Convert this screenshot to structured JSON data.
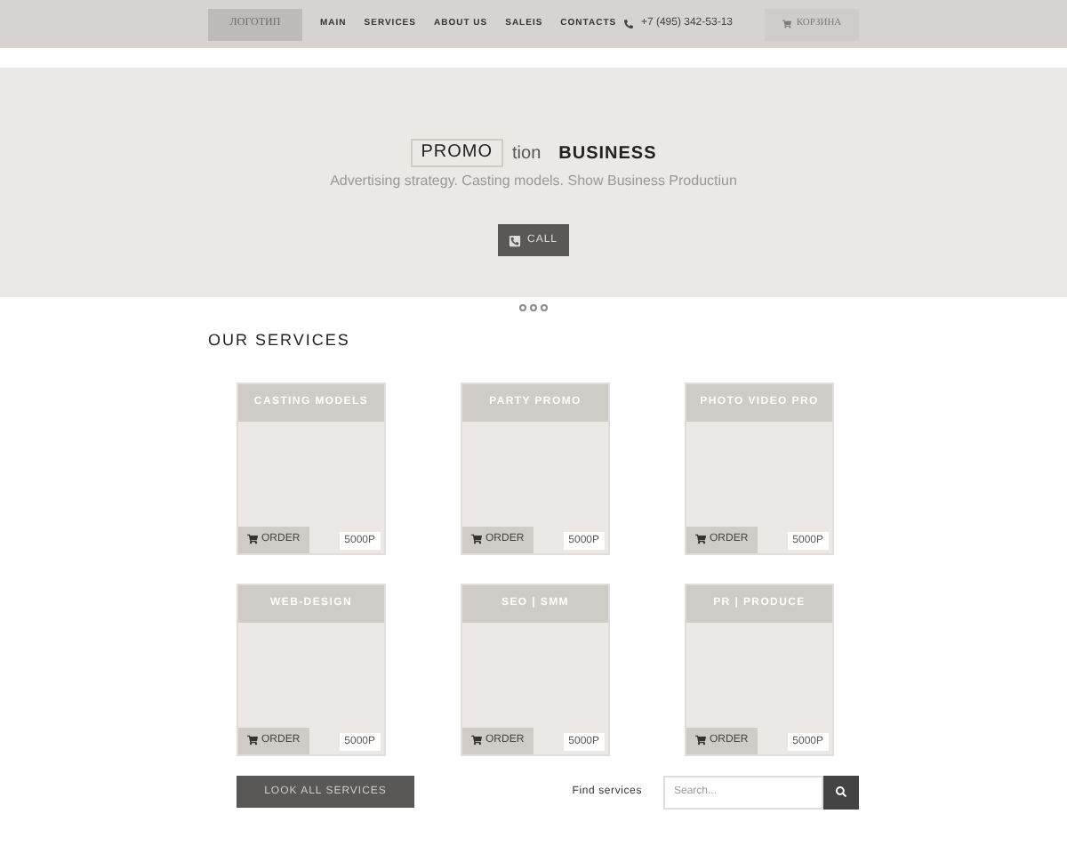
{
  "header": {
    "logo": "ЛОГОТИП",
    "nav": [
      "MAIN",
      "SERVICES",
      "ABOUT US",
      "SALEIS",
      "CONTACTS"
    ],
    "phone": "+7 (495) 342-53-13",
    "cart": "КОРЗИНА"
  },
  "hero": {
    "title_boxed": "PROMO",
    "title_rest": "tion",
    "title_bold": "BUSINESS",
    "subtitle": "Advertising strategy. Casting models. Show Business Productiun",
    "call_button": "CALL"
  },
  "services": {
    "heading": "OUR SERVICES",
    "cards": [
      {
        "title": "CASTING MODELS",
        "order": "ORDER",
        "price": "5000P"
      },
      {
        "title": "PARTY PROMO",
        "order": "ORDER",
        "price": "5000P"
      },
      {
        "title": "PHOTO VIDEO PRO",
        "order": "ORDER",
        "price": "5000P"
      },
      {
        "title": "WEB-DESIGN",
        "order": "ORDER",
        "price": "5000P"
      },
      {
        "title": "SEO | SMM",
        "order": "ORDER",
        "price": "5000P"
      },
      {
        "title": "PR | PRODUCE",
        "order": "ORDER",
        "price": "5000P"
      }
    ],
    "all_button": "LOOK ALL SERVICES",
    "find_label": "Find services",
    "search": {
      "placeholder": "Search..."
    }
  }
}
